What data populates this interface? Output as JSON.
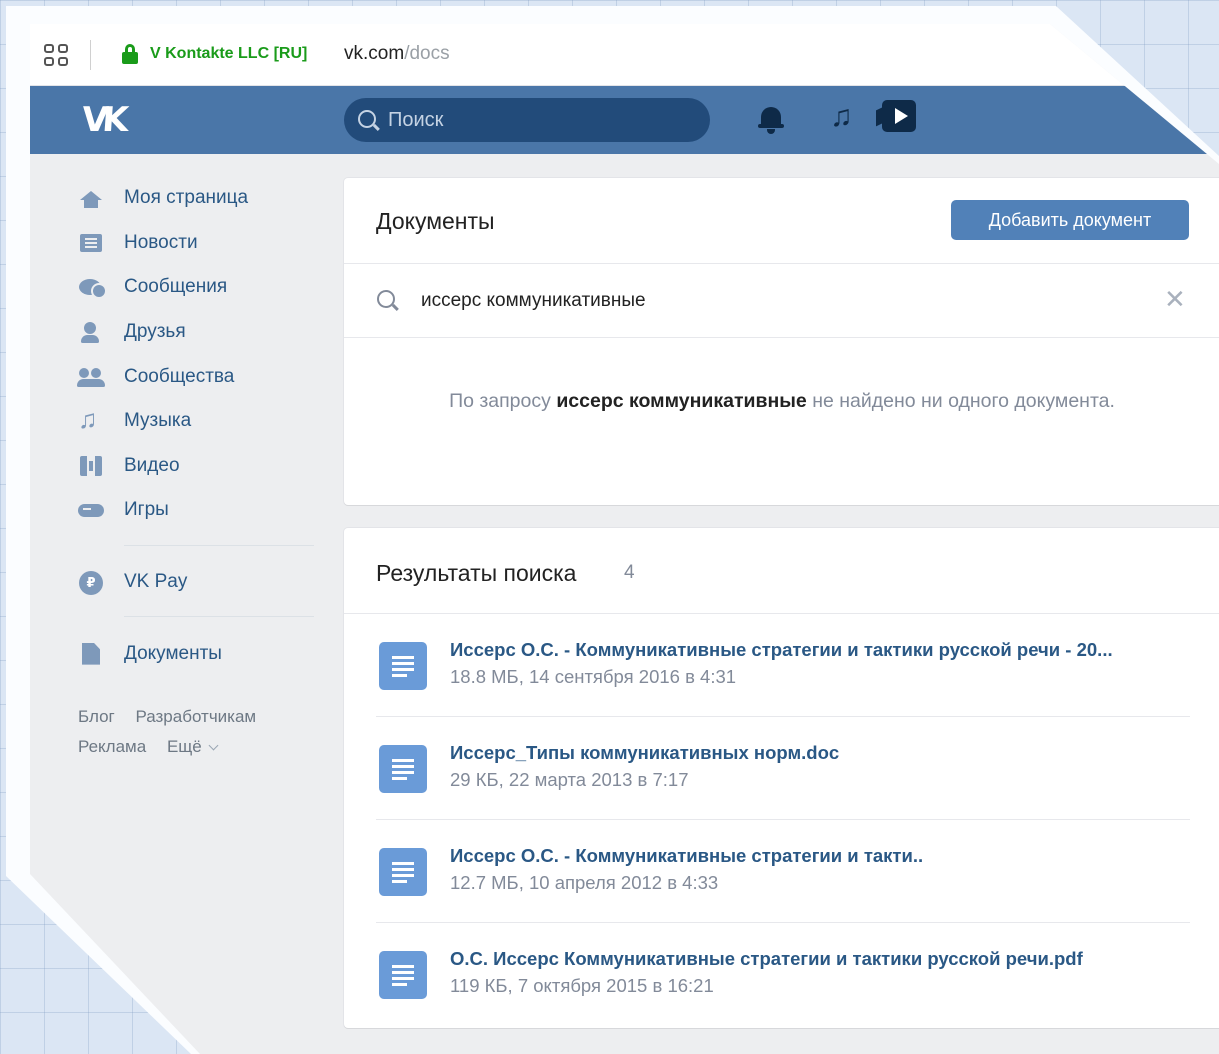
{
  "browser": {
    "site_name": "V Kontakte LLC [RU]",
    "url_host": "vk.com",
    "url_path": "/docs"
  },
  "header": {
    "logo": "VK",
    "search_placeholder": "Поиск"
  },
  "sidebar": {
    "items": [
      {
        "label": "Моя страница",
        "icon": "home-icon"
      },
      {
        "label": "Новости",
        "icon": "news-icon"
      },
      {
        "label": "Сообщения",
        "icon": "messages-icon"
      },
      {
        "label": "Друзья",
        "icon": "friends-icon"
      },
      {
        "label": "Сообщества",
        "icon": "groups-icon"
      },
      {
        "label": "Музыка",
        "icon": "music-icon"
      },
      {
        "label": "Видео",
        "icon": "video-icon"
      },
      {
        "label": "Игры",
        "icon": "games-icon"
      }
    ],
    "vkpay": {
      "label": "VK Pay",
      "icon": "vkpay-icon"
    },
    "documents": {
      "label": "Документы",
      "icon": "document-icon"
    },
    "footer": {
      "blog": "Блог",
      "developers": "Разработчикам",
      "ads": "Реклама",
      "more": "Ещё"
    }
  },
  "docs_panel": {
    "title": "Документы",
    "add_button": "Добавить документ",
    "query": "иссерс коммуникативные",
    "empty_prefix": "По запросу",
    "empty_query": "иссерс коммуникативные",
    "empty_suffix": "не найдено ни одного документа."
  },
  "results": {
    "title": "Результаты поиска",
    "count": "4",
    "items": [
      {
        "title": "Иссерс О.С. - Коммуникативные стратегии и тактики русской речи - 20...",
        "meta": "18.8 МБ, 14 сентября 2016 в 4:31"
      },
      {
        "title": "Иссерс_Типы коммуникативных норм.doc",
        "meta": "29 КБ, 22 марта 2013 в 7:17"
      },
      {
        "title": "Иссерс О.С. - Коммуникативные стратегии и такти..",
        "meta": "12.7 МБ, 10 апреля 2012 в 4:33"
      },
      {
        "title": "О.С. Иссерс Коммуникативные стратегии и тактики русской речи.pdf",
        "meta": "119 КБ, 7 октября 2015 в 16:21"
      }
    ]
  },
  "colors": {
    "header_blue": "#4a76a8",
    "link_blue": "#2a5885",
    "button_blue": "#5181b8",
    "secure_green": "#1a9b1a"
  }
}
